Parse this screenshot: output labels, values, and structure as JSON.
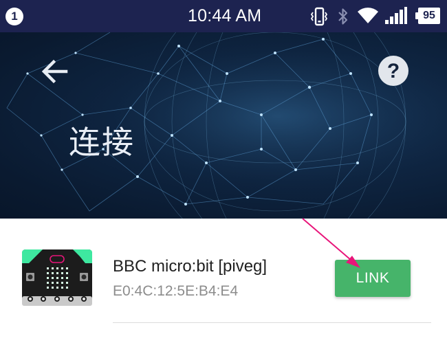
{
  "status_bar": {
    "notification_count": "1",
    "time": "10:44 AM",
    "battery_level": "95",
    "icons": [
      "vibrate-icon",
      "bluetooth-icon",
      "wifi-icon",
      "cell-signal-icon",
      "battery-icon"
    ]
  },
  "header": {
    "title": "连接",
    "back_icon": "arrow-left-icon",
    "help_icon": "help-icon"
  },
  "device": {
    "name": "BBC micro:bit [piveg]",
    "address": "E0:4C:12:5E:B4:E4",
    "link_label": "LINK",
    "thumbnail_icon": "microbit-board-icon"
  },
  "colors": {
    "status_bar": "#1d2350",
    "hero_background": "#0e2440",
    "link_button": "#46b46a",
    "annotation_arrow": "#e8157a",
    "microbit_accent": "#3ee8a0"
  }
}
